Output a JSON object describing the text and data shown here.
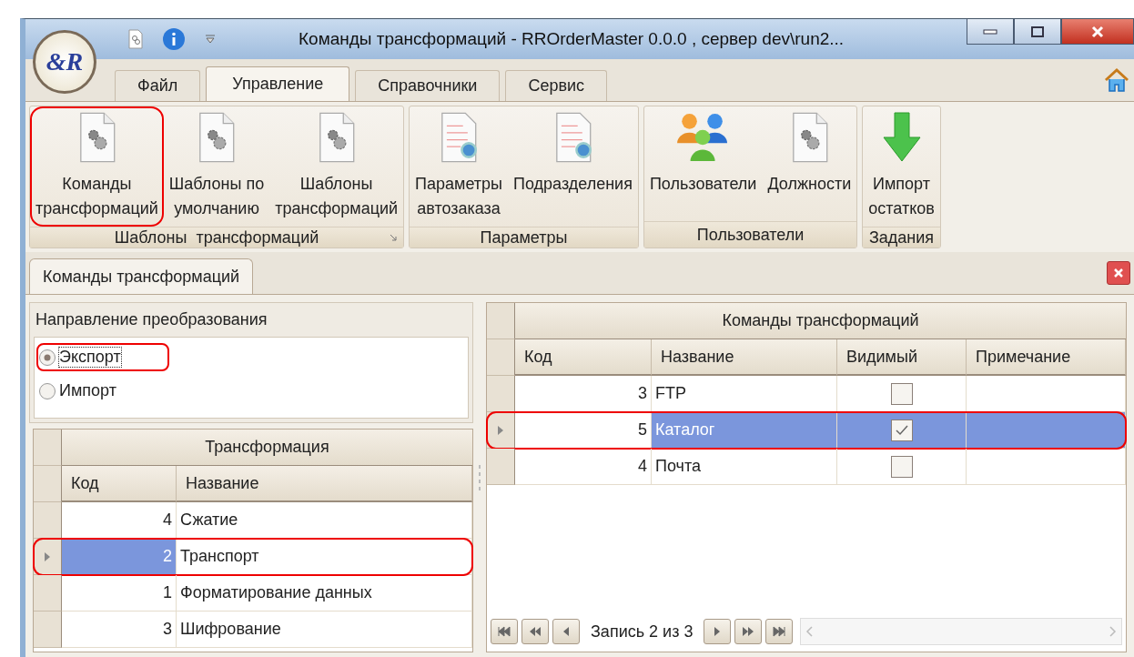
{
  "window": {
    "title": "Команды трансформаций - RROrderMaster 0.0.0 , сервер dev\\run2...",
    "logo": "&R"
  },
  "ribbon_tabs": [
    {
      "label": "Файл",
      "selected": false
    },
    {
      "label": "Управление",
      "selected": true
    },
    {
      "label": "Справочники",
      "selected": false
    },
    {
      "label": "Сервис",
      "selected": false
    }
  ],
  "ribbon_groups": [
    {
      "title": "Шаблоны  трансформаций",
      "launcher": true,
      "buttons": [
        {
          "lines": [
            "Команды",
            "трансформаций"
          ],
          "kind": "gears",
          "highlighted": true
        },
        {
          "lines": [
            "Шаблоны по",
            "умолчанию"
          ],
          "kind": "gears",
          "highlighted": false
        },
        {
          "lines": [
            "Шаблоны",
            "трансформаций"
          ],
          "kind": "gears",
          "highlighted": false
        }
      ]
    },
    {
      "title": "Параметры",
      "launcher": false,
      "buttons": [
        {
          "lines": [
            "Параметры",
            "автозаказа"
          ],
          "kind": "list",
          "highlighted": false
        },
        {
          "lines": [
            "Подразделения"
          ],
          "kind": "list",
          "highlighted": false
        }
      ]
    },
    {
      "title": "Пользователи",
      "launcher": false,
      "buttons": [
        {
          "lines": [
            "Пользователи"
          ],
          "kind": "users",
          "highlighted": false
        },
        {
          "lines": [
            "Должности"
          ],
          "kind": "gears",
          "highlighted": false
        }
      ]
    },
    {
      "title": "Задания",
      "launcher": false,
      "buttons": [
        {
          "lines": [
            "Импорт",
            "остатков"
          ],
          "kind": "arrow",
          "highlighted": false
        }
      ]
    }
  ],
  "document_tab": {
    "label": "Команды трансформаций"
  },
  "direction": {
    "title": "Направление преобразования",
    "options": [
      {
        "label": "Экспорт",
        "selected": true,
        "highlighted": true
      },
      {
        "label": "Импорт",
        "selected": false,
        "highlighted": false
      }
    ]
  },
  "left_grid": {
    "band": "Трансформация",
    "columns": [
      "Код",
      "Название"
    ],
    "rows": [
      {
        "code": "4",
        "name": "Сжатие",
        "selected": false,
        "highlighted": false
      },
      {
        "code": "2",
        "name": "Транспорт",
        "selected": true,
        "highlighted": true
      },
      {
        "code": "1",
        "name": "Форматирование данных",
        "selected": false,
        "highlighted": false
      },
      {
        "code": "3",
        "name": "Шифрование",
        "selected": false,
        "highlighted": false
      }
    ]
  },
  "right_grid": {
    "band": "Команды трансформаций",
    "columns": [
      "Код",
      "Название",
      "Видимый",
      "Примечание"
    ],
    "rows": [
      {
        "code": "3",
        "name": "FTP",
        "visible": false,
        "selected": false,
        "highlighted": false
      },
      {
        "code": "5",
        "name": "Каталог",
        "visible": true,
        "selected": true,
        "highlighted": true
      },
      {
        "code": "4",
        "name": "Почта",
        "visible": false,
        "selected": false,
        "highlighted": false
      }
    ]
  },
  "navigator": {
    "text": "Запись 2 из 3"
  }
}
